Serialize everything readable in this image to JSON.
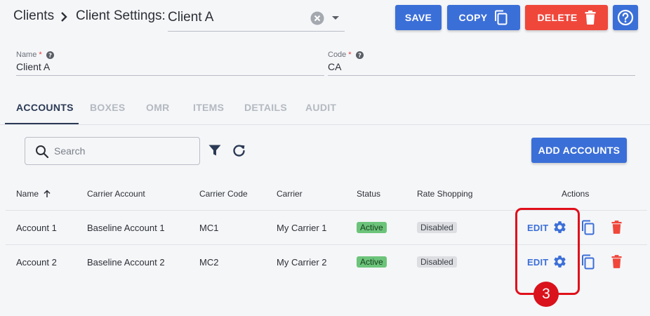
{
  "breadcrumb": {
    "clients": "Clients",
    "settings": "Client Settings:"
  },
  "client_select": {
    "value": "Client A"
  },
  "toolbar": {
    "save": "SAVE",
    "copy": "COPY",
    "delete": "DELETE"
  },
  "fields": {
    "name": {
      "label": "Name",
      "required": "*",
      "value": "Client A"
    },
    "code": {
      "label": "Code",
      "required": "*",
      "value": "CA"
    }
  },
  "tabs": [
    "ACCOUNTS",
    "BOXES",
    "OMR",
    "ITEMS",
    "DETAILS",
    "AUDIT"
  ],
  "search": {
    "placeholder": "Search"
  },
  "add_button": "ADD ACCOUNTS",
  "table": {
    "headers": [
      "Name",
      "Carrier Account",
      "Carrier Code",
      "Carrier",
      "Status",
      "Rate Shopping",
      "Actions"
    ],
    "rows": [
      {
        "name": "Account 1",
        "carrier_account": "Baseline Account 1",
        "carrier_code": "MC1",
        "carrier": "My Carrier 1",
        "status": "Active",
        "rate_shopping": "Disabled",
        "edit": "EDIT"
      },
      {
        "name": "Account 2",
        "carrier_account": "Baseline Account 2",
        "carrier_code": "MC2",
        "carrier": "My Carrier 2",
        "status": "Active",
        "rate_shopping": "Disabled",
        "edit": "EDIT"
      }
    ]
  },
  "annotation": {
    "step": "3"
  },
  "colors": {
    "primary": "#3b6fd8",
    "danger": "#f0473b",
    "active_badge": "#6cc47a",
    "highlight": "#e0101a"
  }
}
